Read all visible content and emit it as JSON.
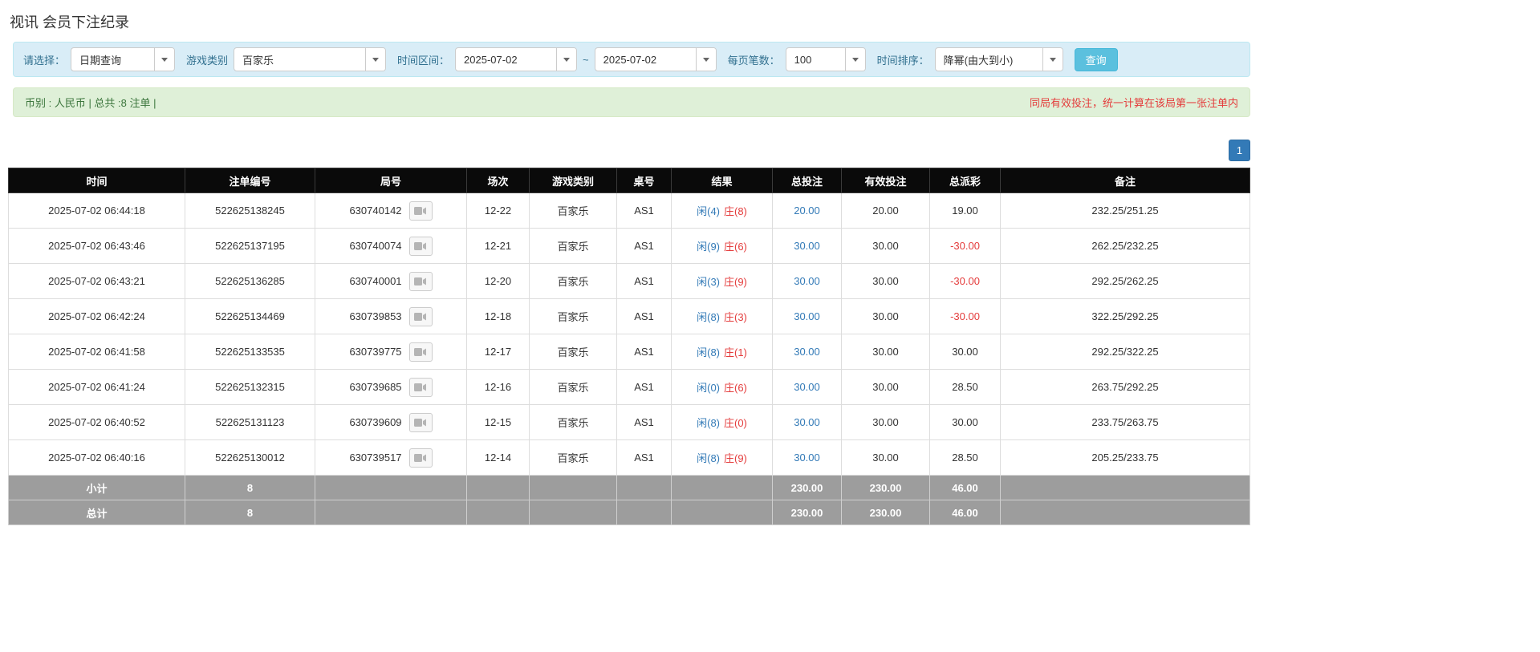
{
  "page": {
    "title": "视讯 会员下注纪录"
  },
  "colors": {
    "filter_bar_bg": "#d9edf7",
    "summary_bar_bg": "#dff0d8",
    "summary_text_green": "#3c763d",
    "warning_text_red": "#e43c3c",
    "search_button_blue": "#5bc0de",
    "pagination_blue": "#337ab7",
    "link_blue": "#337ab7",
    "result_player_blue": "#337ab7",
    "result_banker_red": "#e43c3c",
    "table_header_bg": "#0a0a0a",
    "table_footer_bg": "#9d9d9d"
  },
  "filters": {
    "select_label": "请选择：",
    "select_value": "日期查询",
    "game_type_label": "游戏类别",
    "game_type_value": "百家乐",
    "time_range_label": "时间区间：",
    "date_from": "2025-07-02",
    "range_separator": "~",
    "date_to": "2025-07-02",
    "page_size_label": "每页笔数：",
    "page_size_value": "100",
    "sort_label": "时间排序：",
    "sort_value": "降幂(由大到小)",
    "search_button": "查询"
  },
  "summary": {
    "left": "币别 : 人民币 | 总共 :8 注单 |",
    "right": "同局有效投注，统一计算在该局第一张注单内"
  },
  "pagination": {
    "current": "1"
  },
  "table": {
    "headers": [
      "时间",
      "注单编号",
      "局号",
      "场次",
      "游戏类别",
      "桌号",
      "结果",
      "总投注",
      "有效投注",
      "总派彩",
      "备注"
    ],
    "rows": [
      {
        "time": "2025-07-02 06:44:18",
        "bet_id": "522625138245",
        "round": "630740142",
        "session": "12-22",
        "game": "百家乐",
        "table": "AS1",
        "xian": "闲(4)",
        "zhuang": "庄(8)",
        "total_bet": "20.00",
        "valid_bet": "20.00",
        "payout": "19.00",
        "note": "232.25/251.25"
      },
      {
        "time": "2025-07-02 06:43:46",
        "bet_id": "522625137195",
        "round": "630740074",
        "session": "12-21",
        "game": "百家乐",
        "table": "AS1",
        "xian": "闲(9)",
        "zhuang": "庄(6)",
        "total_bet": "30.00",
        "valid_bet": "30.00",
        "payout": "-30.00",
        "note": "262.25/232.25"
      },
      {
        "time": "2025-07-02 06:43:21",
        "bet_id": "522625136285",
        "round": "630740001",
        "session": "12-20",
        "game": "百家乐",
        "table": "AS1",
        "xian": "闲(3)",
        "zhuang": "庄(9)",
        "total_bet": "30.00",
        "valid_bet": "30.00",
        "payout": "-30.00",
        "note": "292.25/262.25"
      },
      {
        "time": "2025-07-02 06:42:24",
        "bet_id": "522625134469",
        "round": "630739853",
        "session": "12-18",
        "game": "百家乐",
        "table": "AS1",
        "xian": "闲(8)",
        "zhuang": "庄(3)",
        "total_bet": "30.00",
        "valid_bet": "30.00",
        "payout": "-30.00",
        "note": "322.25/292.25"
      },
      {
        "time": "2025-07-02 06:41:58",
        "bet_id": "522625133535",
        "round": "630739775",
        "session": "12-17",
        "game": "百家乐",
        "table": "AS1",
        "xian": "闲(8)",
        "zhuang": "庄(1)",
        "total_bet": "30.00",
        "valid_bet": "30.00",
        "payout": "30.00",
        "note": "292.25/322.25"
      },
      {
        "time": "2025-07-02 06:41:24",
        "bet_id": "522625132315",
        "round": "630739685",
        "session": "12-16",
        "game": "百家乐",
        "table": "AS1",
        "xian": "闲(0)",
        "zhuang": "庄(6)",
        "total_bet": "30.00",
        "valid_bet": "30.00",
        "payout": "28.50",
        "note": "263.75/292.25"
      },
      {
        "time": "2025-07-02 06:40:52",
        "bet_id": "522625131123",
        "round": "630739609",
        "session": "12-15",
        "game": "百家乐",
        "table": "AS1",
        "xian": "闲(8)",
        "zhuang": "庄(0)",
        "total_bet": "30.00",
        "valid_bet": "30.00",
        "payout": "30.00",
        "note": "233.75/263.75"
      },
      {
        "time": "2025-07-02 06:40:16",
        "bet_id": "522625130012",
        "round": "630739517",
        "session": "12-14",
        "game": "百家乐",
        "table": "AS1",
        "xian": "闲(8)",
        "zhuang": "庄(9)",
        "total_bet": "30.00",
        "valid_bet": "30.00",
        "payout": "28.50",
        "note": "205.25/233.75"
      }
    ],
    "subtotal": {
      "label": "小计",
      "count": "8",
      "total_bet": "230.00",
      "valid_bet": "230.00",
      "payout": "46.00"
    },
    "total": {
      "label": "总计",
      "count": "8",
      "total_bet": "230.00",
      "valid_bet": "230.00",
      "payout": "46.00"
    }
  }
}
